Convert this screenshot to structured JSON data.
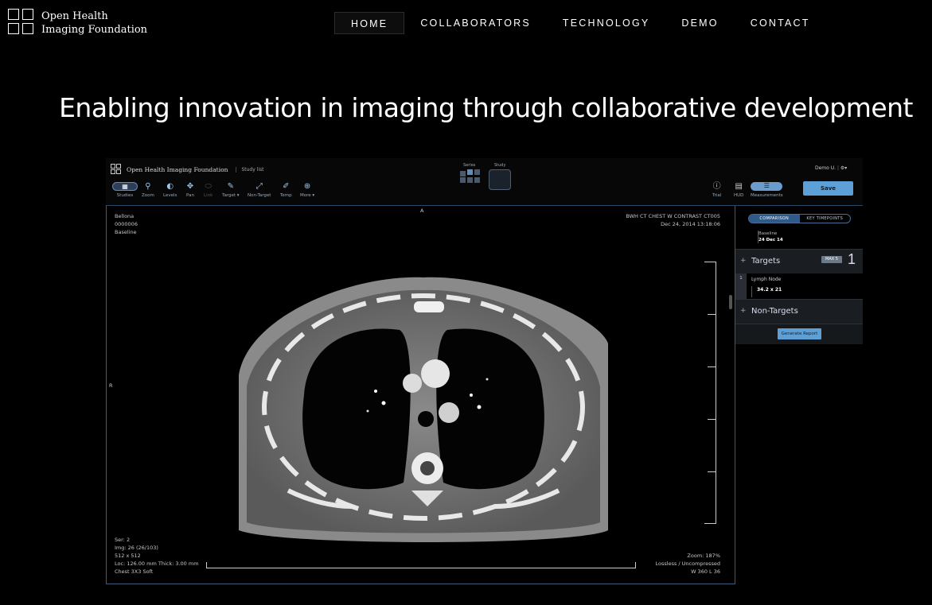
{
  "site": {
    "logo_line1": "Open Health",
    "logo_line2": "Imaging Foundation",
    "nav": [
      "HOME",
      "COLLABORATORS",
      "TECHNOLOGY",
      "DEMO",
      "CONTACT"
    ],
    "active_nav": "HOME",
    "hero": "Enabling innovation in imaging through collaborative development"
  },
  "viewer": {
    "brand": "Open Health Imaging Foundation",
    "study_list": "Study list",
    "tools": [
      "Studies",
      "Zoom",
      "Levels",
      "Pan",
      "Link",
      "Target ▾",
      "Non-Target",
      "Temp",
      "More ▾"
    ],
    "series_label": "Series",
    "study_label": "Study",
    "right_tools": [
      "Trial",
      "HUD",
      "Measurements"
    ],
    "user": "Demo U.",
    "save": "Save",
    "overlay": {
      "patient_name": "Bellona",
      "patient_id": "0000006",
      "timepoint": "Baseline",
      "study_desc": "BWH CT CHEST W CONTRAST CT005",
      "study_date": "Dec 24, 2014 13:18:06",
      "orient_top": "A",
      "orient_left": "R",
      "ser": "Ser: 2",
      "img": "Img: 26 (26/103)",
      "dims": "512 x 512",
      "loc": "Loc: 126.00 mm Thick: 3.00 mm",
      "kernel": "Chest 3X3 Soft",
      "zoom": "Zoom: 187%",
      "compression": "Lossless / Uncompressed",
      "wl": "W 360 L 36"
    },
    "panel": {
      "tab_comparison": "COMPARISON",
      "tab_key": "KEY TIMEPOINTS",
      "baseline_label": "Baseline",
      "baseline_date": "24 Dec 14",
      "targets": "Targets",
      "max": "MAX 5",
      "target_count": "1",
      "lesion_num": "1",
      "lesion_name": "Lymph Node",
      "lesion_size": "34.2 x 21",
      "non_targets": "Non-Targets",
      "generate": "Generate Report"
    }
  }
}
